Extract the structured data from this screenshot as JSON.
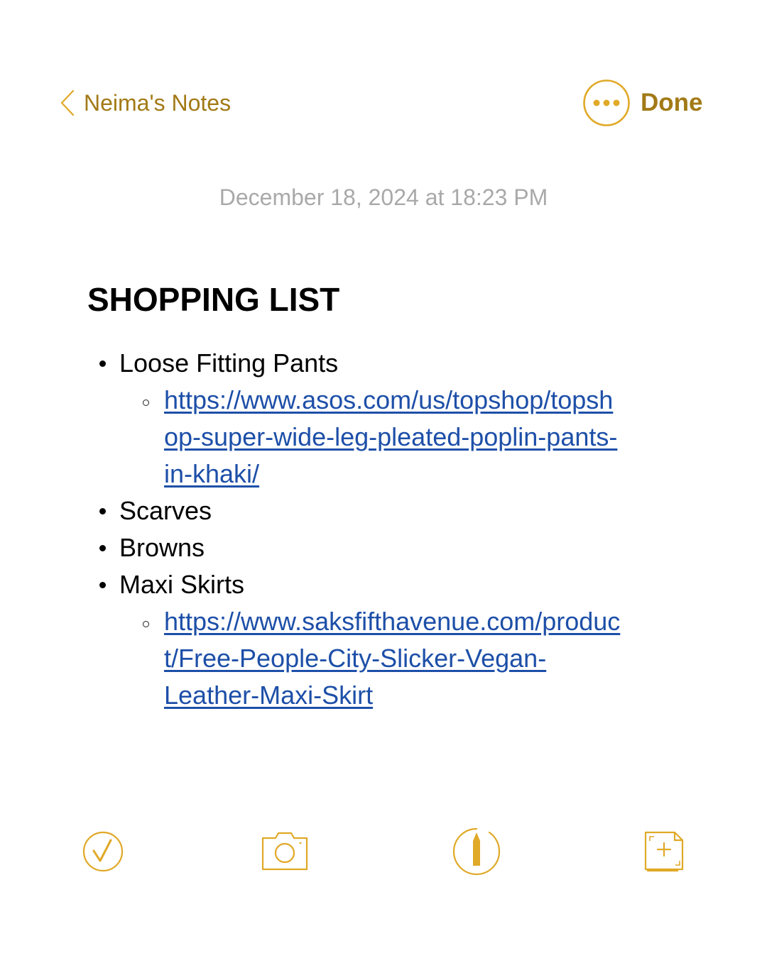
{
  "header": {
    "back_label": "Neima's Notes",
    "done_label": "Done",
    "accent_color": "#a27a16",
    "icon_color": "#e0a927"
  },
  "note": {
    "timestamp": "December 18, 2024 at 18:23 PM",
    "title": "SHOPPING LIST",
    "items": [
      {
        "label": "Loose Fitting Pants",
        "link_lines": [
          "https://www.asos.com/us/topshop/topsh",
          "op-super-wide-leg-pleated-poplin-pants-",
          "in-khaki/"
        ]
      },
      {
        "label": "Scarves"
      },
      {
        "label": "Browns"
      },
      {
        "label": "Maxi Skirts",
        "link_lines": [
          "https://www.saksfifthavenue.com/produc",
          "t/Free-People-City-Slicker-Vegan-",
          "Leather-Maxi-Skirt "
        ]
      }
    ],
    "link_color": "#1d4fa8"
  },
  "toolbar": {
    "icons": [
      "checklist-icon",
      "camera-icon",
      "markup-pen-icon",
      "new-note-icon"
    ]
  }
}
